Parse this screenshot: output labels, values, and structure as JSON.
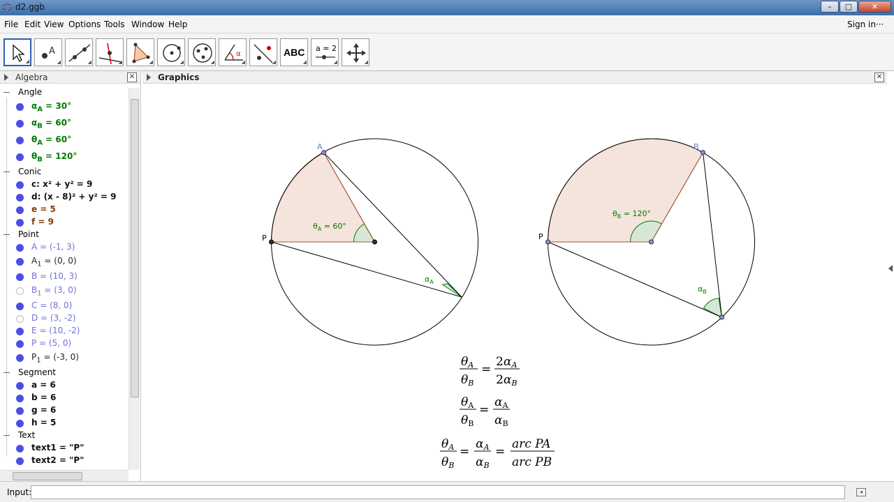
{
  "window": {
    "title": "d2.ggb",
    "min": "–",
    "max": "□",
    "close": "✕"
  },
  "menu": {
    "items": [
      "File",
      "Edit",
      "View",
      "Options",
      "Tools",
      "Window",
      "Help"
    ],
    "signin": "Sign in···"
  },
  "toolbar": {
    "text_tool": "ABC",
    "slider_tool": "a = 2",
    "undo": "↶",
    "redo": "↷",
    "help": "?",
    "settings": "⚙"
  },
  "algebra": {
    "title": "Algebra",
    "groups": {
      "angle": {
        "label": "Angle",
        "items": [
          "α_A = 30°",
          "α_B = 60°",
          "θ_A = 60°",
          "θ_B = 120°"
        ]
      },
      "conic": {
        "label": "Conic",
        "items": [
          "c: x² + y² = 9",
          "d: (x - 8)² + y² = 9",
          "e = 5",
          "f = 9"
        ]
      },
      "point": {
        "label": "Point",
        "items": [
          "A = (-1, 3)",
          "A₁ = (0, 0)",
          "B = (10, 3)",
          "B₁ = (3, 0)",
          "C = (8, 0)",
          "D = (3, -2)",
          "E = (10, -2)",
          "P = (5, 0)",
          "P₁ = (-3, 0)"
        ]
      },
      "segment": {
        "label": "Segment",
        "items": [
          "a = 6",
          "b = 6",
          "g = 6",
          "h = 5"
        ]
      },
      "text": {
        "label": "Text",
        "items": [
          "text1 = \"P\"",
          "text2 = \"P\""
        ]
      }
    }
  },
  "graphics": {
    "title": "Graphics",
    "labels": {
      "A": "A",
      "B": "B",
      "P1": "P",
      "P2": "P",
      "thetaA": "θA = 60°",
      "thetaB": "θB = 120°",
      "alphaA": "αA",
      "alphaB": "αB"
    },
    "equations": {
      "eq1": {
        "lhs_num": "θ_A",
        "lhs_den": "θ_B",
        "rhs_num": "2α_A",
        "rhs_den": "2α_B"
      },
      "eq2": {
        "lhs_num": "θ_A",
        "lhs_den": "θ_B",
        "rhs_num": "α_A",
        "rhs_den": "α_B"
      },
      "eq3": {
        "lhs_num": "θ_A",
        "lhs_den": "θ_B",
        "mid_num": "α_A",
        "mid_den": "α_B",
        "rhs_num": "arc PA",
        "rhs_den": "arc PB"
      }
    }
  },
  "input": {
    "label": "Input:"
  },
  "colors": {
    "sector_fill": "#f4e4dc",
    "sector_stroke": "#a0522d",
    "angle_fill": "#d8e6d8",
    "angle_stroke": "#007a00",
    "point_blue": "#4b4ee6"
  }
}
